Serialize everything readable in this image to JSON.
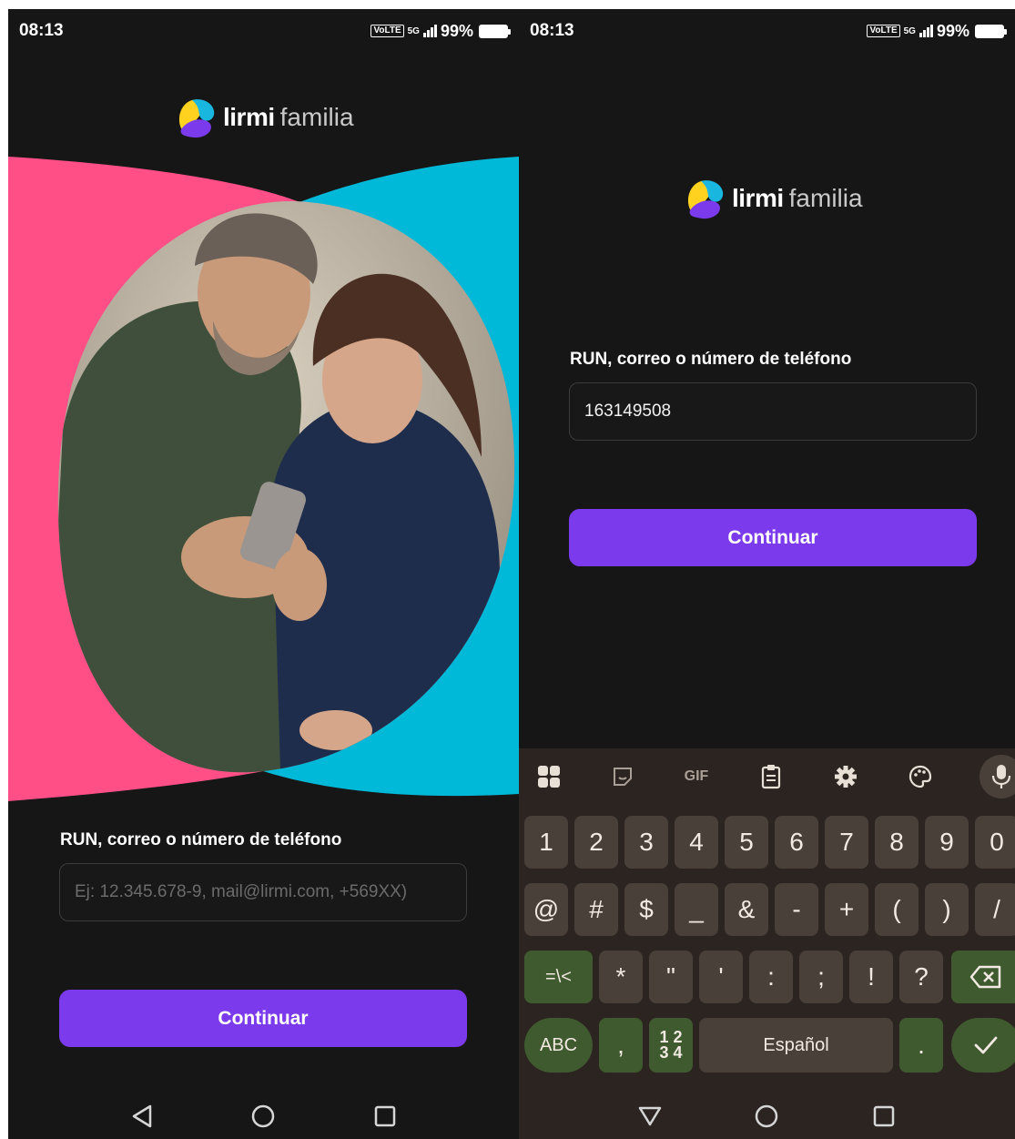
{
  "left": {
    "status": {
      "time": "08:13",
      "volte": "VoLTE",
      "net": "5G",
      "battery": "99%"
    },
    "logo": {
      "brand_a": "lirmi",
      "brand_b": "familia"
    },
    "hero": {
      "bg_left": "#ff4f86",
      "bg_right": "#00b8d8"
    },
    "form": {
      "label": "RUN, correo o número de teléfono",
      "placeholder": "Ej: 12.345.678-9, mail@lirmi.com, +569XX)",
      "value": ""
    },
    "button": {
      "label": "Continuar",
      "color": "#7c3aed"
    },
    "nav": [
      "back-icon",
      "home-icon",
      "recents-icon"
    ]
  },
  "right": {
    "status": {
      "time": "08:13",
      "volte": "VoLTE",
      "net": "5G",
      "battery": "99%"
    },
    "logo": {
      "brand_a": "lirmi",
      "brand_b": "familia"
    },
    "form": {
      "label": "RUN, correo o número de teléfono",
      "value": "163149508"
    },
    "button": {
      "label": "Continuar"
    },
    "keyboard": {
      "toolbar": [
        "apps-icon",
        "sticker-icon",
        "GIF",
        "clipboard-icon",
        "settings-icon",
        "palette-icon",
        "mic-icon"
      ],
      "row1": [
        "1",
        "2",
        "3",
        "4",
        "5",
        "6",
        "7",
        "8",
        "9",
        "0"
      ],
      "row2": [
        "@",
        "#",
        "$",
        "_",
        "&",
        "-",
        "+",
        "(",
        ")",
        "/"
      ],
      "row3": [
        "=\\<",
        "*",
        "\"",
        "'",
        ":",
        ";",
        "!",
        "?"
      ],
      "row4": {
        "abc": "ABC",
        "comma": ",",
        "numpad_top": "1 2",
        "numpad_bottom": "3 4",
        "space": "Español",
        "period": "."
      }
    },
    "nav": [
      "back-down-icon",
      "home-icon",
      "recents-icon"
    ]
  }
}
